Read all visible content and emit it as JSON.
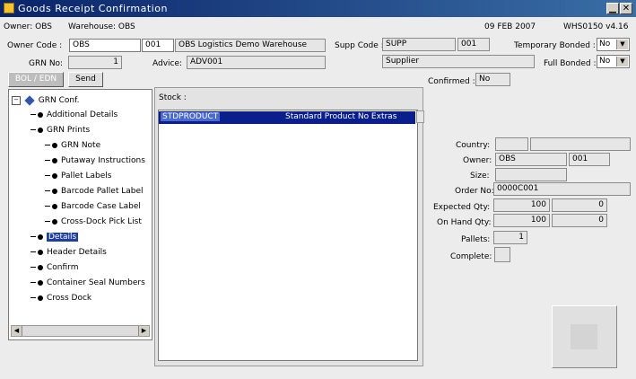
{
  "window": {
    "title": "Goods Receipt Confirmation",
    "minimize": "▁",
    "close": "✕"
  },
  "header": {
    "owner_label": "Owner: OBS",
    "warehouse_label": "Warehouse: OBS",
    "date": "09 FEB 2007",
    "version": "WHS0150 v4.16"
  },
  "form": {
    "owner_code_label": "Owner Code :",
    "owner_code": "OBS",
    "warehouse_code": "001",
    "warehouse_name": "OBS Logistics Demo Warehouse",
    "grn_no_label": "GRN No:",
    "grn_no": "1",
    "advice_label": "Advice:",
    "advice": "ADV001",
    "supp_code_label": "Supp Code :",
    "supp_code": "SUPP",
    "supp_branch": "001",
    "supplier_name": "Supplier",
    "temp_bonded_label": "Temporary Bonded :",
    "temp_bonded_value": "No",
    "full_bonded_label": "Full Bonded :",
    "full_bonded_value": "No",
    "confirmed_label": "Confirmed :",
    "confirmed_value": "No"
  },
  "buttons": {
    "bol_edn": "BOL / EDN",
    "send": "Send"
  },
  "tree": {
    "root": "GRN Conf.",
    "items": [
      {
        "label": "Additional Details"
      },
      {
        "label": "GRN Prints"
      },
      {
        "label": "GRN Note"
      },
      {
        "label": "Putaway Instructions"
      },
      {
        "label": "Pallet Labels"
      },
      {
        "label": "Barcode Pallet Label"
      },
      {
        "label": "Barcode Case Label"
      },
      {
        "label": "Cross-Dock Pick List"
      },
      {
        "label": "Details"
      },
      {
        "label": "Header Details"
      },
      {
        "label": "Confirm"
      },
      {
        "label": "Container Seal Numbers"
      },
      {
        "label": "Cross Dock"
      }
    ]
  },
  "stock": {
    "label": "Stock :",
    "rows": [
      {
        "code": "STDPRODUCT",
        "description": "Standard Product No Extras"
      }
    ]
  },
  "details": {
    "country_label": "Country:",
    "owner_label": "Owner:",
    "owner_value": "OBS",
    "owner_branch": "001",
    "size_label": "Size:",
    "order_no_label": "Order No:",
    "order_no": "0000C001",
    "expected_qty_label": "Expected Qty:",
    "expected_qty": "100",
    "expected_qty2": "0",
    "on_hand_qty_label": "On Hand Qty:",
    "on_hand_qty": "100",
    "on_hand_qty2": "0",
    "pallets_label": "Pallets:",
    "pallets": "1",
    "complete_label": "Complete:"
  }
}
